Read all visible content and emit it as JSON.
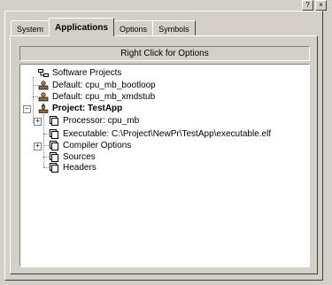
{
  "tabs": [
    {
      "label": "System",
      "active": false
    },
    {
      "label": "Applications",
      "active": true
    },
    {
      "label": "Options",
      "active": false
    },
    {
      "label": "Symbols",
      "active": false
    }
  ],
  "header": {
    "label": "Right Click for Options"
  },
  "tree": {
    "software_projects": "Software Projects",
    "default_bootloop": "Default: cpu_mb_bootloop",
    "default_xmdstub": "Default: cpu_mb_xmdstub",
    "project": "Project: TestApp",
    "processor": "Processor: cpu_mb",
    "executable": "Executable: C:\\Project\\NewPr\\TestApp\\executable.elf",
    "compiler_options": "Compiler Options",
    "sources": "Sources",
    "headers": "Headers"
  },
  "colors": {
    "window_bg": "#d4d0c8",
    "tree_bg": "#ffffff"
  }
}
